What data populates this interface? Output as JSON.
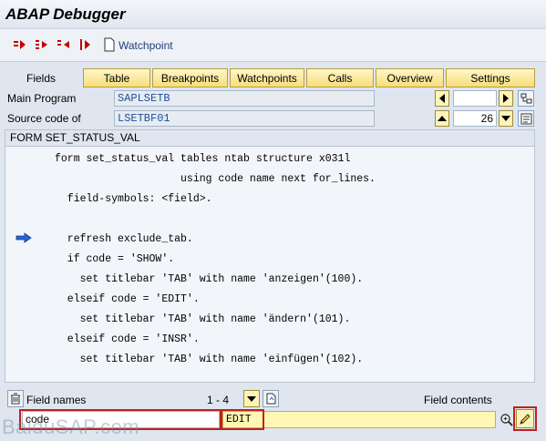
{
  "window": {
    "title": "ABAP Debugger"
  },
  "toolbar": {
    "watchpoint_label": "Watchpoint",
    "icons": [
      "single-step-icon",
      "execute-icon",
      "return-icon",
      "continue-icon",
      "watchpoint-icon"
    ]
  },
  "tabs": {
    "fields_label": "Fields",
    "items": [
      "Table",
      "Breakpoints",
      "Watchpoints",
      "Calls",
      "Overview",
      "Settings"
    ]
  },
  "program": {
    "main_label": "Main Program",
    "main_value": "SAPLSETB",
    "source_label": "Source code of",
    "source_value": "LSETBF01",
    "line_number": "26"
  },
  "code": {
    "header": "FORM SET_STATUS_VAL",
    "lines": [
      "form set_status_val tables ntab structure x031l",
      "                    using code name next for_lines.",
      "  field-symbols: <field>.",
      "",
      "  refresh exclude_tab.",
      "  if code = 'SHOW'.",
      "    set titlebar 'TAB' with name 'anzeigen'(100).",
      "  elseif code = 'EDIT'.",
      "    set titlebar 'TAB' with name 'ändern'(101).",
      "  elseif code = 'INSR'.",
      "    set titlebar 'TAB' with name 'einfügen'(102)."
    ],
    "current_line_index": 4
  },
  "fields": {
    "names_label": "Field names",
    "range_text": "1 - 4",
    "contents_label": "Field contents",
    "name_value": "code",
    "content_value": "EDIT"
  },
  "watermark": {
    "text": "BaiduSAP.com"
  },
  "colors": {
    "accent_yellow": "#f7de7a",
    "highlight_red": "#c02020",
    "code_blue": "#1e4f9a",
    "background": "#dfe6ef"
  }
}
